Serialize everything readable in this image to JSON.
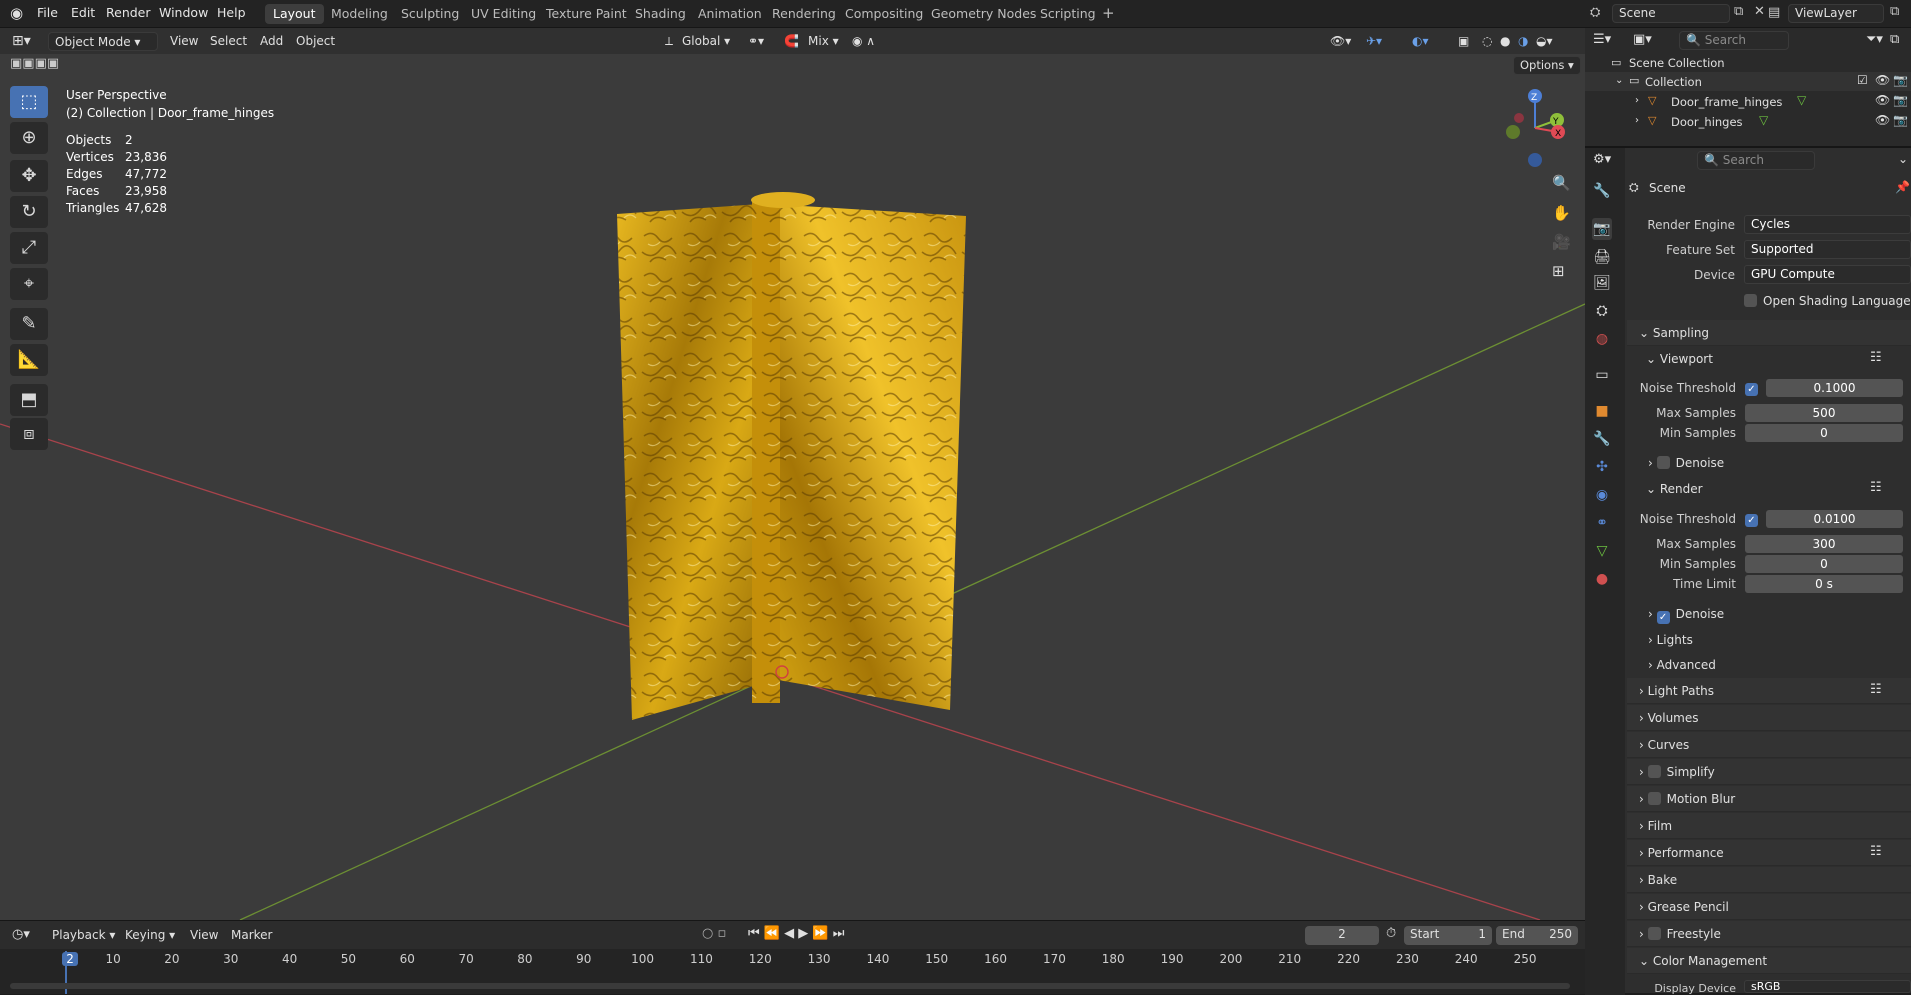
{
  "menus": [
    "File",
    "Edit",
    "Render",
    "Window",
    "Help"
  ],
  "workspaces": [
    "Layout",
    "Modeling",
    "Sculpting",
    "UV Editing",
    "Texture Paint",
    "Shading",
    "Animation",
    "Rendering",
    "Compositing",
    "Geometry Nodes",
    "Scripting"
  ],
  "add_tab_icon": "plus-icon",
  "scene_name": "Scene",
  "view_layer": "ViewLayer",
  "header": {
    "mode": "Object Mode",
    "view": "View",
    "select": "Select",
    "add": "Add",
    "object": "Object",
    "orientation": "Global",
    "snap_mix": "Mix",
    "options": "Options"
  },
  "overlay": {
    "perspective": "User Perspective",
    "collection": "(2) Collection | Door_frame_hinges",
    "stats": [
      {
        "label": "Objects",
        "value": "2"
      },
      {
        "label": "Vertices",
        "value": "23,836"
      },
      {
        "label": "Edges",
        "value": "47,772"
      },
      {
        "label": "Faces",
        "value": "23,958"
      },
      {
        "label": "Triangles",
        "value": "47,628"
      }
    ]
  },
  "gizmo": {
    "z": "Z",
    "y": "Y",
    "x": "X"
  },
  "outliner": {
    "search_placeholder": "Search",
    "root": "Scene Collection",
    "collection": "Collection",
    "items": [
      "Door_frame_hinges",
      "Door_hinges"
    ]
  },
  "props": {
    "search_placeholder": "Search",
    "context": "Scene",
    "render_engine_label": "Render Engine",
    "render_engine": "Cycles",
    "feature_set_label": "Feature Set",
    "feature_set": "Supported",
    "device_label": "Device",
    "device": "GPU Compute",
    "osl": "Open Shading Language",
    "sampling": "Sampling",
    "viewport": "Viewport",
    "render": "Render",
    "noise_threshold_label": "Noise Threshold",
    "vp_noise": "0.1000",
    "r_noise": "0.0100",
    "max_samples_label": "Max Samples",
    "vp_max": "500",
    "r_max": "300",
    "min_samples_label": "Min Samples",
    "vp_min": "0",
    "r_min": "0",
    "time_limit_label": "Time Limit",
    "time_limit": "0 s",
    "denoise": "Denoise",
    "lights": "Lights",
    "advanced": "Advanced",
    "sections": [
      "Light Paths",
      "Volumes",
      "Curves",
      "Simplify",
      "Motion Blur",
      "Film",
      "Performance",
      "Bake",
      "Grease Pencil",
      "Freestyle",
      "Color Management"
    ],
    "display_device_label": "Display Device",
    "display_device": "sRGB"
  },
  "timeline": {
    "playback": "Playback",
    "keying": "Keying",
    "view": "View",
    "marker": "Marker",
    "current_frame": "2",
    "start_label": "Start",
    "start": "1",
    "end_label": "End",
    "end": "250",
    "ticks": [
      "2",
      "10",
      "20",
      "30",
      "40",
      "50",
      "60",
      "70",
      "80",
      "90",
      "100",
      "110",
      "120",
      "130",
      "140",
      "150",
      "160",
      "170",
      "180",
      "190",
      "200",
      "210",
      "220",
      "230",
      "240",
      "250"
    ]
  },
  "colors": {
    "accent": "#4772b3",
    "x_axis": "#c0404a",
    "y_axis": "#7aa33a",
    "gold": "#c8960c"
  }
}
